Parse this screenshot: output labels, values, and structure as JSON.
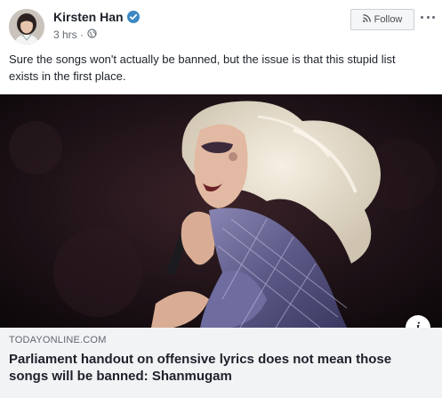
{
  "post": {
    "author_name": "Kirsten Han",
    "timestamp": "3 hrs",
    "follow_label": "Follow",
    "text": "Sure the songs won't actually be banned, but the issue is that this stupid list exists in the first place."
  },
  "link_preview": {
    "domain": "TODAYONLINE.COM",
    "title": "Parliament handout on offensive lyrics does not mean those songs will be banned: Shanmugam",
    "info_label": "i"
  },
  "icons": {
    "verified": "verified-badge-icon",
    "privacy": "globe-icon",
    "follow": "rss-icon",
    "more": "more-options-icon",
    "info": "info-icon"
  },
  "colors": {
    "verified": "#3b88c3",
    "meta_text": "#616770",
    "caption_background": "#f2f3f5",
    "button_border": "#ccd0d5"
  }
}
